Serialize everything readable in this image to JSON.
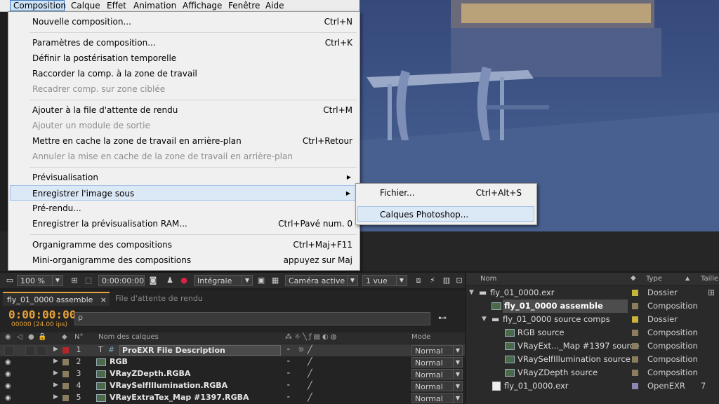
{
  "menubar": {
    "items": [
      "Composition",
      "Calque",
      "Effet",
      "Animation",
      "Affichage",
      "Fenêtre",
      "Aide"
    ]
  },
  "dropdown": {
    "items": [
      {
        "label": "Nouvelle composition...",
        "shortcut": "Ctrl+N"
      },
      {
        "label": "Paramètres de composition...",
        "shortcut": "Ctrl+K"
      },
      {
        "label": "Définir la postérisation temporelle",
        "shortcut": ""
      },
      {
        "label": "Raccorder la comp. à la zone de travail",
        "shortcut": ""
      },
      {
        "label": "Recadrer comp. sur zone ciblée",
        "shortcut": ""
      },
      {
        "label": "Ajouter à la file d'attente de rendu",
        "shortcut": "Ctrl+M"
      },
      {
        "label": "Ajouter un module de sortie",
        "shortcut": ""
      },
      {
        "label": "Mettre en cache la zone de travail en arrière-plan",
        "shortcut": "Ctrl+Retour"
      },
      {
        "label": "Annuler la mise en cache de la zone de travail en arrière-plan",
        "shortcut": ""
      },
      {
        "label": "Prévisualisation",
        "shortcut": ""
      },
      {
        "label": "Enregistrer l'image sous",
        "shortcut": ""
      },
      {
        "label": "Pré-rendu...",
        "shortcut": ""
      },
      {
        "label": "Enregistrer la prévisualisation RAM...",
        "shortcut": "Ctrl+Pavé num. 0"
      },
      {
        "label": "Organigramme des compositions",
        "shortcut": "Ctrl+Maj+F11"
      },
      {
        "label": "Mini-organigramme des compositions",
        "shortcut": "appuyez sur Maj"
      }
    ]
  },
  "submenu": {
    "items": [
      {
        "label": "Fichier...",
        "shortcut": "Ctrl+Alt+S"
      },
      {
        "label": "Calques Photoshop...",
        "shortcut": ""
      }
    ]
  },
  "viewer_toolbar": {
    "zoom": "100 %",
    "timecode": "0:00:00:00",
    "quality": "Intégrale",
    "camera": "Caméra active",
    "views": "1 vue"
  },
  "timeline": {
    "tabs": [
      "fly_01_0000 assemble",
      "File d'attente de rendu"
    ],
    "timecode": "0:00:00:00",
    "fps": "00000 (24.00 ips)",
    "search_placeholder": "ρ",
    "col_num": "N°",
    "col_name": "Nom des calques",
    "col_mode": "Mode",
    "layers": [
      {
        "num": "1",
        "name": "ProEXR File Description",
        "mode": "Normal",
        "color": "#b3272b"
      },
      {
        "num": "2",
        "name": "RGB",
        "mode": "Normal",
        "color": "#8c7d5e"
      },
      {
        "num": "3",
        "name": "VRayZDepth.RGBA",
        "mode": "Normal",
        "color": "#8c7d5e"
      },
      {
        "num": "4",
        "name": "VRaySelfIllumination.RGBA",
        "mode": "Normal",
        "color": "#8c7d5e"
      },
      {
        "num": "5",
        "name": "VRayExtraTex_Map #1397.RGBA",
        "mode": "Normal",
        "color": "#8c7d5e"
      }
    ]
  },
  "project": {
    "col_name": "Nom",
    "col_type": "Type",
    "col_size": "Taille",
    "rows": [
      {
        "name": "fly_01_0000.exr",
        "type": "Dossier",
        "label_color": "#c8b43c"
      },
      {
        "name": "fly_01_0000 assemble",
        "type": "Composition",
        "label_color": "#8c7d5e"
      },
      {
        "name": "fly_01_0000 source comps",
        "type": "Dossier",
        "label_color": "#c8b43c"
      },
      {
        "name": "RGB source",
        "type": "Composition",
        "label_color": "#8c7d5e"
      },
      {
        "name": "VRayExt..._Map #1397 source",
        "type": "Composition",
        "label_color": "#8c7d5e"
      },
      {
        "name": "VRaySelfIllumination source",
        "type": "Composition",
        "label_color": "#8c7d5e"
      },
      {
        "name": "VRayZDepth source",
        "type": "Composition",
        "label_color": "#8c7d5e"
      },
      {
        "name": "fly_01_0000.exr",
        "type": "OpenEXR",
        "label_color": "#8e84b8",
        "size": "7"
      }
    ]
  }
}
